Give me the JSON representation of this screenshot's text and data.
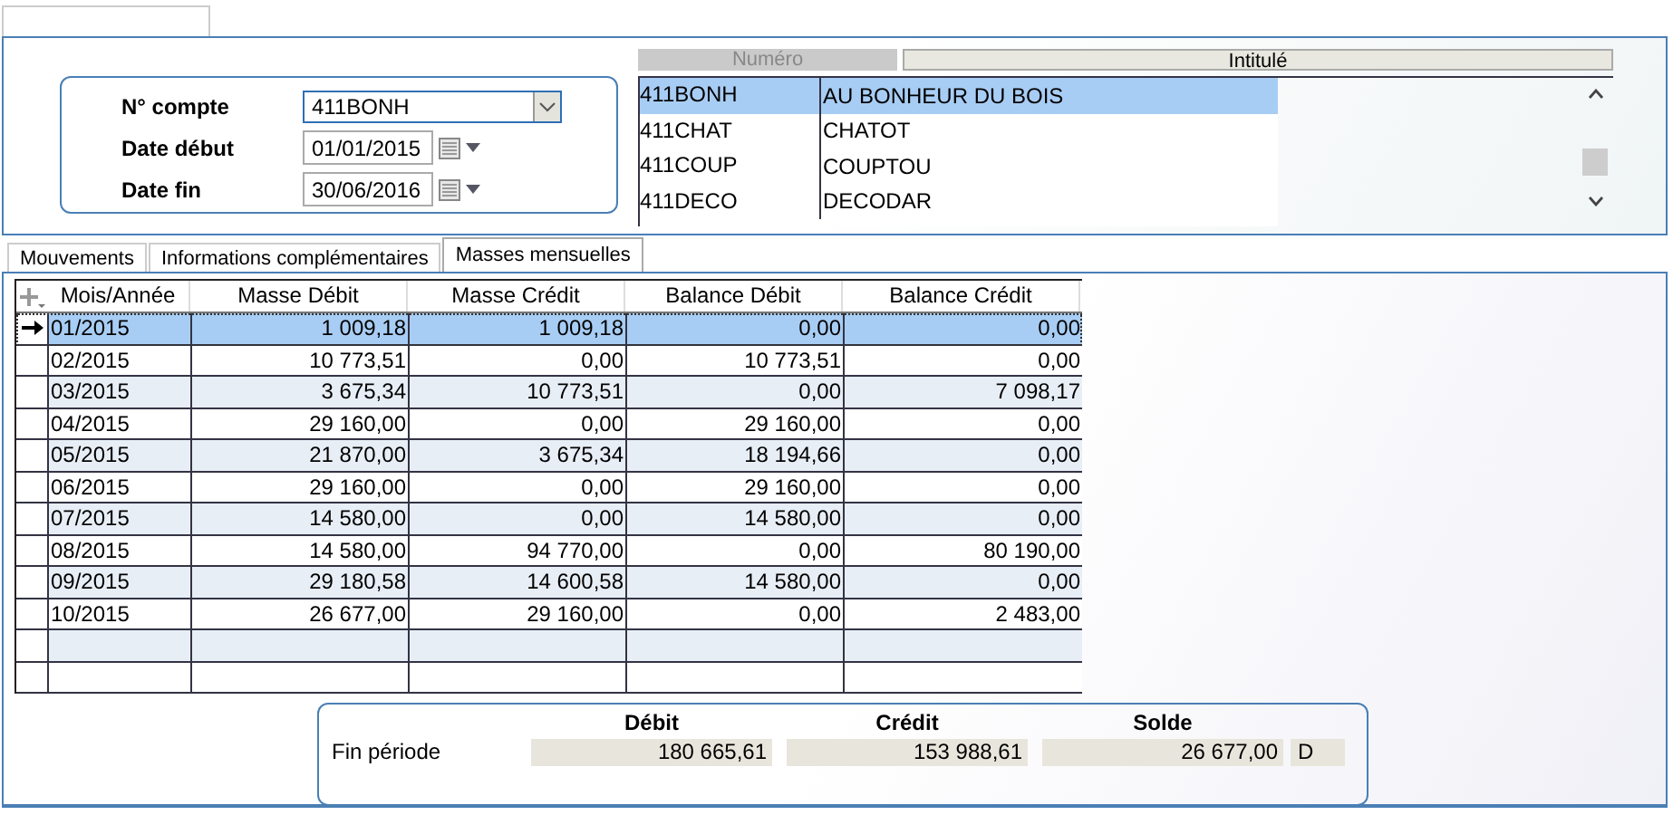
{
  "filter": {
    "fields": [
      {
        "label": "N° compte",
        "value": "411BONH",
        "kind": "combo"
      },
      {
        "label": "Date début",
        "value": "01/01/2015",
        "kind": "date"
      },
      {
        "label": "Date fin",
        "value": "30/06/2016",
        "kind": "date"
      }
    ]
  },
  "accounts": {
    "columns": [
      {
        "label": "Numéro",
        "disabled": true
      },
      {
        "label": "Intitulé",
        "disabled": false
      }
    ],
    "rows": [
      {
        "numero": "411BONH",
        "intitule": "AU BONHEUR DU BOIS",
        "selected": true
      },
      {
        "numero": "411CHAT",
        "intitule": "CHATOT",
        "selected": false
      },
      {
        "numero": "411COUP",
        "intitule": "COUPTOU",
        "selected": false
      },
      {
        "numero": "411DECO",
        "intitule": "DECODAR",
        "selected": false
      }
    ]
  },
  "tabs": [
    {
      "label": "Mouvements",
      "selected": false
    },
    {
      "label": "Informations complémentaires",
      "selected": false
    },
    {
      "label": "Masses mensuelles",
      "selected": true
    }
  ],
  "grid": {
    "columns": [
      "Mois/Année",
      "Masse Débit",
      "Masse Crédit",
      "Balance Débit",
      "Balance Crédit"
    ],
    "rows": [
      {
        "cells": [
          "01/2015",
          "1 009,18",
          "1 009,18",
          "0,00",
          "0,00"
        ],
        "selected": true
      },
      {
        "cells": [
          "02/2015",
          "10 773,51",
          "0,00",
          "10 773,51",
          "0,00"
        ],
        "selected": false
      },
      {
        "cells": [
          "03/2015",
          "3 675,34",
          "10 773,51",
          "0,00",
          "7 098,17"
        ],
        "selected": false
      },
      {
        "cells": [
          "04/2015",
          "29 160,00",
          "0,00",
          "29 160,00",
          "0,00"
        ],
        "selected": false
      },
      {
        "cells": [
          "05/2015",
          "21 870,00",
          "3 675,34",
          "18 194,66",
          "0,00"
        ],
        "selected": false
      },
      {
        "cells": [
          "06/2015",
          "29 160,00",
          "0,00",
          "29 160,00",
          "0,00"
        ],
        "selected": false
      },
      {
        "cells": [
          "07/2015",
          "14 580,00",
          "0,00",
          "14 580,00",
          "0,00"
        ],
        "selected": false
      },
      {
        "cells": [
          "08/2015",
          "14 580,00",
          "94 770,00",
          "0,00",
          "80 190,00"
        ],
        "selected": false
      },
      {
        "cells": [
          "09/2015",
          "29 180,58",
          "14 600,58",
          "14 580,00",
          "0,00"
        ],
        "selected": false
      },
      {
        "cells": [
          "10/2015",
          "26 677,00",
          "29 160,00",
          "0,00",
          "2 483,00"
        ],
        "selected": false
      }
    ]
  },
  "summary": {
    "columns": [
      "Débit",
      "Crédit",
      "Solde"
    ],
    "label": "Fin période",
    "values": [
      "180 665,61",
      "153 988,61",
      "26 677,00"
    ],
    "sign": "D"
  }
}
